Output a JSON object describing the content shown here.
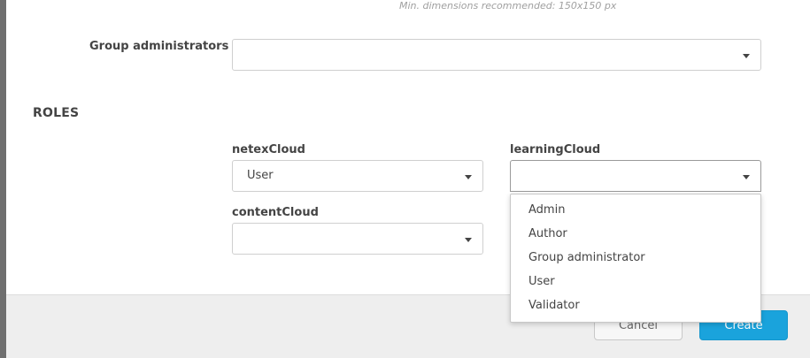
{
  "hint": "Min. dimensions recommended: 150x150 px",
  "group_admins": {
    "label": "Group administrators",
    "value": ""
  },
  "roles": {
    "title": "ROLES",
    "netexCloud": {
      "label": "netexCloud",
      "value": "User"
    },
    "learningCloud": {
      "label": "learningCloud",
      "value": "",
      "options": [
        "Admin",
        "Author",
        "Group administrator",
        "User",
        "Validator"
      ]
    },
    "contentCloud": {
      "label": "contentCloud",
      "value": ""
    }
  },
  "footer": {
    "cancel": "Cancel",
    "create": "Create"
  },
  "colors": {
    "primary": "#1aa3dc",
    "overlay": "#6f6f6f"
  }
}
